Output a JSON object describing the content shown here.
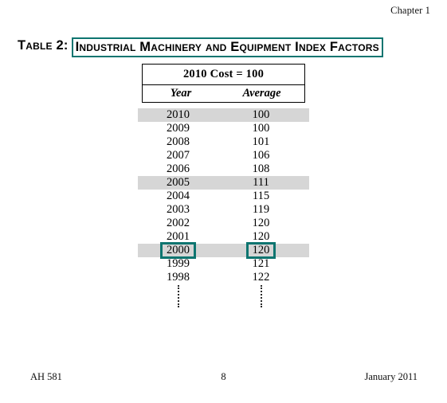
{
  "page": {
    "header_right": "Chapter 1",
    "footer_left": "AH 581",
    "footer_center": "8",
    "footer_right": "January 2011"
  },
  "caption": {
    "label": "Table 2:",
    "title": "Industrial Machinery and Equipment Index Factors"
  },
  "colors": {
    "highlight_teal": "#0e7570",
    "row_shade_grey": "#d6d6d6",
    "table_border": "#000000",
    "text": "#000000"
  },
  "table": {
    "basis_header": "2010 Cost = 100",
    "columns": [
      "Year",
      "Average"
    ],
    "rows": [
      {
        "year": "2010",
        "average": "100",
        "shaded": true,
        "boxed": false
      },
      {
        "year": "2009",
        "average": "100",
        "shaded": false,
        "boxed": false
      },
      {
        "year": "2008",
        "average": "101",
        "shaded": false,
        "boxed": false
      },
      {
        "year": "2007",
        "average": "106",
        "shaded": false,
        "boxed": false
      },
      {
        "year": "2006",
        "average": "108",
        "shaded": false,
        "boxed": false
      },
      {
        "year": "2005",
        "average": "111",
        "shaded": true,
        "boxed": false
      },
      {
        "year": "2004",
        "average": "115",
        "shaded": false,
        "boxed": false
      },
      {
        "year": "2003",
        "average": "119",
        "shaded": false,
        "boxed": false
      },
      {
        "year": "2002",
        "average": "120",
        "shaded": false,
        "boxed": false
      },
      {
        "year": "2001",
        "average": "120",
        "shaded": false,
        "boxed": false
      },
      {
        "year": "2000",
        "average": "120",
        "shaded": true,
        "boxed": true
      },
      {
        "year": "1999",
        "average": "121",
        "shaded": false,
        "boxed": false
      },
      {
        "year": "1998",
        "average": "122",
        "shaded": false,
        "boxed": false
      }
    ],
    "continuation": "vertical-ellipsis"
  },
  "chart_data": {
    "type": "table",
    "title": "Table 2: Industrial Machinery and Equipment Index Factors",
    "subtitle": "2010 Cost = 100",
    "columns": [
      "Year",
      "Average"
    ],
    "x": [
      2010,
      2009,
      2008,
      2007,
      2006,
      2005,
      2004,
      2003,
      2002,
      2001,
      2000,
      1999,
      1998
    ],
    "values": [
      100,
      100,
      101,
      106,
      108,
      111,
      115,
      119,
      120,
      120,
      120,
      121,
      122
    ],
    "xlabel": "Year",
    "ylabel": "Average",
    "annotations": [
      "Rows 2010, 2005 and 2000 are shaded grey",
      "Year 2000 and its Average value 120 are outlined in teal",
      "Vertical dotted lines below 1998 indicate the series continues"
    ]
  }
}
